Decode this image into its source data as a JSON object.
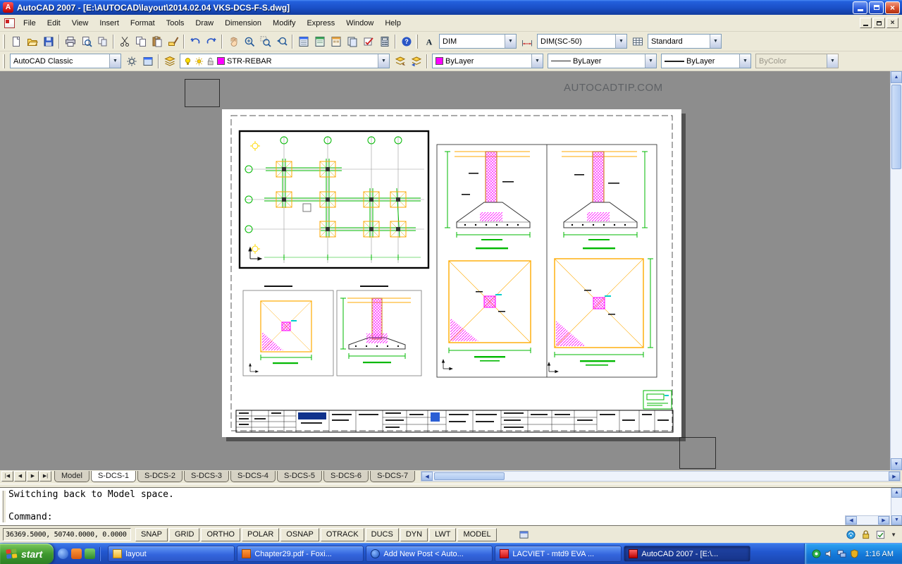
{
  "window": {
    "title": "AutoCAD 2007 - [E:\\AUTOCAD\\layout\\2014.02.04 VKS-DCS-F-S.dwg]"
  },
  "menu": {
    "items": [
      "File",
      "Edit",
      "View",
      "Insert",
      "Format",
      "Tools",
      "Draw",
      "Dimension",
      "Modify",
      "Express",
      "Window",
      "Help"
    ]
  },
  "toolbar_icons": [
    "new",
    "open",
    "save",
    "|",
    "plot",
    "plot-preview",
    "publish",
    "|",
    "cut",
    "copy",
    "paste",
    "match-properties",
    "|",
    "undo",
    "redo",
    "|",
    "pan",
    "zoom-realtime",
    "zoom-window",
    "zoom-previous",
    "|",
    "properties",
    "designcenter",
    "tool-palettes",
    "sheet-set-manager",
    "markup",
    "quick-calc",
    "|",
    "help"
  ],
  "toolbar_styles": {
    "text_style": "DIM",
    "dim_style": "DIM(SC-50)",
    "table_style": "Standard"
  },
  "toolbar_properties": {
    "workspace": "AutoCAD Classic",
    "layer": "STR-REBAR",
    "color": "ByLayer",
    "linetype": "ByLayer",
    "lineweight": "ByLayer",
    "plot_style": "ByColor",
    "layer_color_swatch": "#ff00ff"
  },
  "drawing_area": {
    "watermark": "AUTOCADTIP.COM"
  },
  "layout": {
    "tabs": [
      "Model",
      "S-DCS-1",
      "S-DCS-2",
      "S-DCS-3",
      "S-DCS-4",
      "S-DCS-5",
      "S-DCS-6",
      "S-DCS-7"
    ],
    "active_tab": "S-DCS-1"
  },
  "command": {
    "lines": [
      "Switching back to Model space.",
      "",
      "Command:"
    ]
  },
  "status_bar": {
    "coordinates": "36369.5000, 50740.0000, 0.0000",
    "toggles": [
      "SNAP",
      "GRID",
      "ORTHO",
      "POLAR",
      "OSNAP",
      "OTRACK",
      "DUCS",
      "DYN",
      "LWT",
      "MODEL"
    ]
  },
  "taskbar": {
    "start_label": "start",
    "buttons": [
      {
        "label": "layout",
        "icon": "folder"
      },
      {
        "label": "Chapter29.pdf - Foxi...",
        "icon": "foxit"
      },
      {
        "label": "Add New Post < Auto...",
        "icon": "browser"
      },
      {
        "label": "LACVIET - mtd9 EVA ...",
        "icon": "lacviet"
      },
      {
        "label": "AutoCAD 2007 - [E:\\...",
        "icon": "autocad",
        "active": true
      }
    ],
    "tray_time": "1:16 AM"
  }
}
